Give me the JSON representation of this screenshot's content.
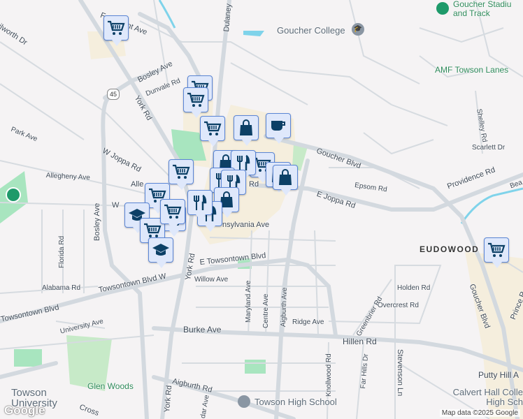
{
  "streets": {
    "fairmount": "Fairmount Ave",
    "kenilworth": "ilworth Dr",
    "bosley_ave_top": "Bosley Ave",
    "dunvale": "Dunvale Rd",
    "york_rd_top": "York Rd",
    "park": "Park Ave",
    "w_joppa": "W Joppa Rd",
    "allegheny": "Allegheny Ave",
    "alle": "Alle",
    "bosley_ave": "Bosley Ave",
    "dulaney": "Dulaney",
    "goucher_blvd_top": "Goucher Blvd",
    "epsom": "Epsom Rd",
    "e_joppa": "E Joppa Rd",
    "providence": "Providence Rd",
    "scarlett": "Scarlett Dr",
    "shelley": "Shelley Rd",
    "pennsylvania": "nsylvania Ave",
    "e_towsontown": "E Towsontown Blvd",
    "towsontown_w": "Towsontown Blvd W",
    "towsontown_blvd": "Towsontown Blvd",
    "alabama": "Alabama Rd",
    "florida": "Florida Rd",
    "willow": "Willow Ave",
    "york_rd_mid": "York Rd",
    "maryland": "Maryland Ave",
    "centre": "Centre Ave",
    "aigburth_ave": "Aigburth Ave",
    "ridge": "Ridge Ave",
    "holden": "Holden Rd",
    "overcrest": "Overcrest Rd",
    "greenbrier": "Greenbrier Rd",
    "hillen": "Hillen Rd",
    "burke": "Burke Ave",
    "university": "University Ave",
    "aigburth_rd": "Aigburth Rd",
    "york_rd_bottom": "York Rd",
    "knollwood": "Knollwood Rd",
    "far_hills": "Far Hills Dr",
    "stevenson": "Stevenson Ln",
    "goucher_blvd": "Goucher Blvd",
    "prince": "Prince R",
    "putty_hill": "Putty Hill A",
    "cross": "Cross",
    "dar": "dar Ave",
    "beav": "Bea",
    "rd_joppa_frag": "Rd",
    "w_frag": "W"
  },
  "places": {
    "goucher_college": "Goucher College",
    "goucher_stadium": "Goucher Stadiu and Track",
    "amf": "AMF Towson Lanes",
    "eudowood": "EUDOWOOD",
    "glen_woods": "Glen Woods",
    "towson_hs": "Towson High School",
    "calvert_hall": "Calvert Hall Colle High Sch",
    "towson_univ": "Towson University"
  },
  "route_shield": "45",
  "markers": [
    "grocery",
    "grocery",
    "grocery",
    "grocery",
    "shopping",
    "cafe",
    "grocery",
    "shopping",
    "grocery",
    "restaurant",
    "restaurant",
    "restaurant",
    "shopping",
    "grocery",
    "shopping",
    "restaurant",
    "shopping",
    "restaurant",
    "grocery",
    "school",
    "grocery",
    "grocery",
    "school",
    "grocery"
  ],
  "attribution": "Map data ©2025 Google",
  "logo": "Google"
}
